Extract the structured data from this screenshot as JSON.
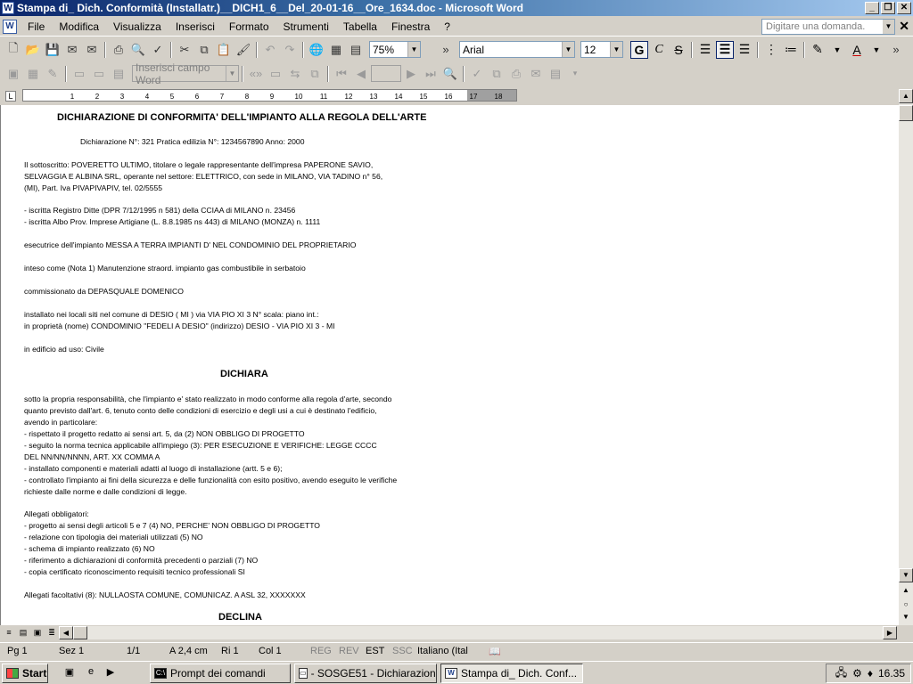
{
  "window": {
    "title": "Stampa di_ Dich. Conformità (Installatr.)__DICH1_6__Del_20-01-16__Ore_1634.doc - Microsoft Word",
    "app_icon": "W"
  },
  "menu": {
    "items": [
      {
        "label": "File",
        "key": "F"
      },
      {
        "label": "Modifica",
        "key": "M"
      },
      {
        "label": "Visualizza",
        "key": "V"
      },
      {
        "label": "Inserisci",
        "key": "I"
      },
      {
        "label": "Formato",
        "key": "F"
      },
      {
        "label": "Strumenti",
        "key": "S"
      },
      {
        "label": "Tabella",
        "key": "T"
      },
      {
        "label": "Finestra",
        "key": "n"
      },
      {
        "label": "?",
        "key": "?"
      }
    ],
    "help_placeholder": "Digitare una domanda."
  },
  "toolbar": {
    "zoom": "75%",
    "font": "Arial",
    "font_size": "12",
    "insert_field": "Inserisci campo Word"
  },
  "document": {
    "lines": [
      {
        "text": "DICHIARAZIONE DI CONFORMITA' DELL'IMPIANTO ALLA REGOLA DELL'ARTE",
        "style": "h"
      },
      {
        "text": "Dichiarazione N°:     321       Pratica edilizia N°: 1234567890              Anno: 2000",
        "style": ""
      },
      {
        "text": "Il sottoscritto:  POVERETTO ULTIMO,    titolare  o  legale  rappresentante  dell'impresa  PAPERONE  SAVIO,",
        "style": ""
      },
      {
        "text": "SELVAGGIA E ALBINA SRL,  operante nel settore: ELETTRICO, con sede in MILANO,  VIA TADINO n° 56,",
        "style": ""
      },
      {
        "text": "(MI),          Part. Iva PIVAPIVAPIV,          tel. 02/5555",
        "style": ""
      },
      {
        "text": "- iscritta Registro Ditte (DPR 7/12/1995 n 581) della CCIAA di MILANO n. 23456",
        "style": ""
      },
      {
        "text": "- iscritta Albo Prov. Imprese Artigiane (L. 8.8.1985 ns 443)  di MILANO (MONZA)  n. 1111",
        "style": ""
      },
      {
        "text": "esecutrice dell'impianto  MESSA A TERRA IMPIANTI D' NEL CONDOMINIO DEL PROPRIETARIO",
        "style": ""
      },
      {
        "text": "inteso come (Nota 1) Manutenzione straord. impianto gas combustibile in serbatoio",
        "style": ""
      },
      {
        "text": "commissionato da DEPASQUALE DOMENICO",
        "style": ""
      },
      {
        "text": "installato nei locali siti nel comune di DESIO  ( MI ) via VIA PIO XI 3   N°      scala:     piano      int.:",
        "style": ""
      },
      {
        "text": "in proprietà  (nome)  CONDOMINIO \"FEDELI A DESIO\"      (indirizzo) DESIO - VIA PIO XI 3 - MI",
        "style": ""
      },
      {
        "text": "in edificio ad uso: Civile",
        "style": ""
      },
      {
        "text": "DICHIARA",
        "style": "h"
      },
      {
        "text": "sotto la propria responsabilità,  che l'impianto   e' stato realizzato in modo conforme alla regola d'arte, secondo",
        "style": ""
      },
      {
        "text": "quanto   previsto   dall'art. 6,  tenuto conto  delle condizioni  di esercizio  e degli usi  a cui è destinato l'edificio,",
        "style": ""
      },
      {
        "text": "avendo in particolare:",
        "style": ""
      },
      {
        "text": "- rispettato il progetto redatto ai sensi art. 5, da (2)  NON OBBLIGO DI PROGETTO",
        "style": ""
      },
      {
        "text": "- seguito la norma tecnica applicabile all'impiego (3): PER ESECUZIONE E VERIFICHE: LEGGE  CCCC",
        "style": ""
      },
      {
        "text": "DEL NN/NN/NNNN, ART. XX COMMA A",
        "style": ""
      },
      {
        "text": "- installato componenti e materiali adatti al luogo di installazione (artt. 5 e 6);",
        "style": ""
      },
      {
        "text": "- controllato l'impianto ai fini della sicurezza e delle funzionalità  con esito positivo, avendo eseguito  le verifiche",
        "style": ""
      },
      {
        "text": "richieste dalle norme e dalle condizioni di legge.",
        "style": ""
      },
      {
        "text": "Allegati obbligatori:",
        "style": ""
      },
      {
        "text": "- progetto ai sensi degli articoli 5 e 7 (4) NO, PERCHE' NON OBBLIGO DI PROGETTO",
        "style": ""
      },
      {
        "text": "- relazione con tipologia dei materiali utilizzati (5)     NO",
        "style": ""
      },
      {
        "text": "- schema di impianto realizzato (6)  NO",
        "style": ""
      },
      {
        "text": "- riferimento a dichiarazioni di conformità precedenti o parziali (7) NO",
        "style": ""
      },
      {
        "text": "- copia certificato riconoscimento requisiti tecnico professionali    SI",
        "style": ""
      },
      {
        "text": "Allegati facoltativi (8):      NULLAOSTA COMUNE,     COMUNICAZ. A ASL 32,    XXXXXXX",
        "style": ""
      },
      {
        "text": "DECLINA",
        "style": "h"
      }
    ]
  },
  "status": {
    "page": "Pg  1",
    "section": "Sez  1",
    "pages": "1/1",
    "at": "A  2,4 cm",
    "line": "Ri  1",
    "col": "Col  1",
    "rec": "REG",
    "rev": "REV",
    "ext": "EST",
    "ovr": "SSC",
    "lang": "Italiano (Ital"
  },
  "taskbar": {
    "start": "Start",
    "tasks": [
      {
        "label": "Prompt dei comandi",
        "icon": "C:\\"
      },
      {
        "label": "- SOSGE51 - Dichiarazion...",
        "icon": "▭"
      },
      {
        "label": "Stampa di_ Dich. Conf...",
        "icon": "W"
      }
    ],
    "clock": "16.35"
  }
}
